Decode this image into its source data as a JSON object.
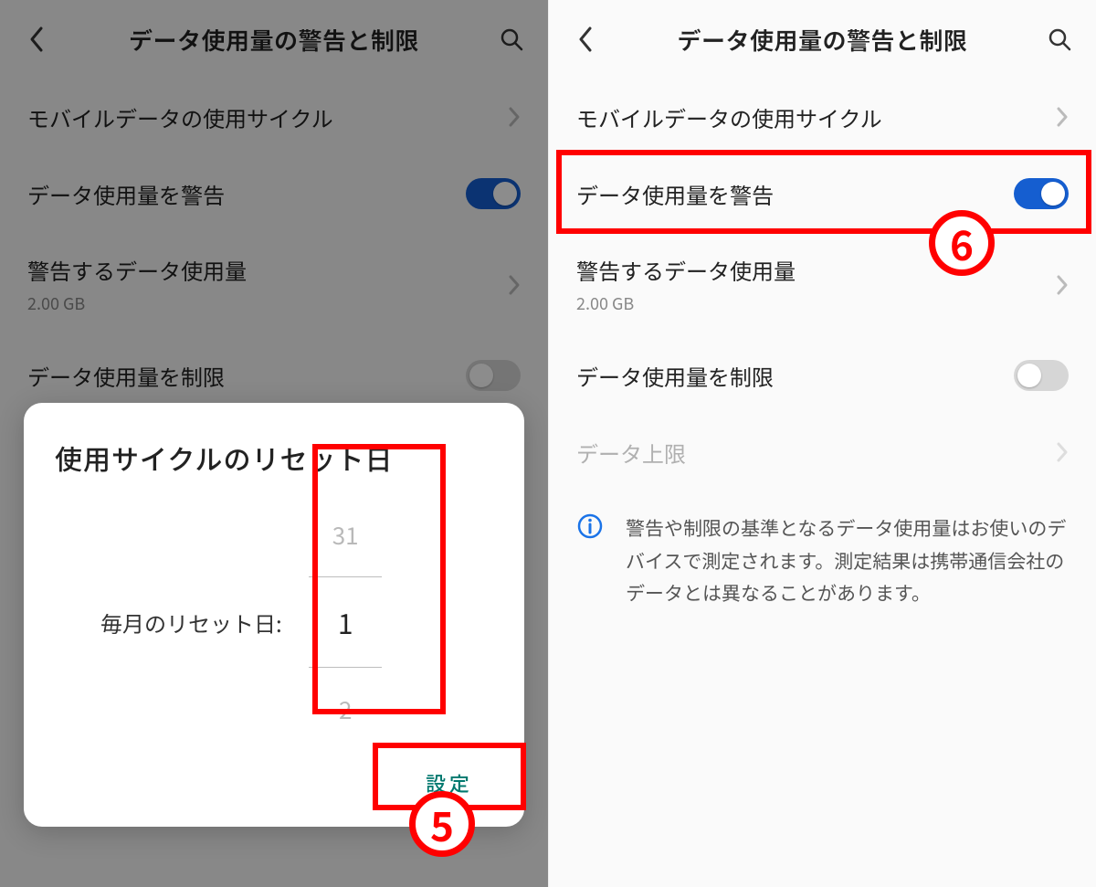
{
  "header": {
    "title": "データ使用量の警告と制限"
  },
  "rows": {
    "cycle": {
      "label": "モバイルデータの使用サイクル"
    },
    "warn": {
      "label": "データ使用量を警告"
    },
    "warn_at": {
      "label": "警告するデータ使用量",
      "sub": "2.00 GB"
    },
    "limit": {
      "label": "データ使用量を制限"
    },
    "cap": {
      "label": "データ上限"
    }
  },
  "info_text": "警告や制限の基準となるデータ使用量はお使いのデバイスで測定されます。測定結果は携帯通信会社のデータとは異なることがあります。",
  "dialog": {
    "title": "使用サイクルのリセット日",
    "field_label": "毎月のリセット日:",
    "options": {
      "prev": "31",
      "sel": "1",
      "next": "2"
    },
    "confirm": "設定"
  },
  "annotations": {
    "step5": "5",
    "step6": "6"
  }
}
